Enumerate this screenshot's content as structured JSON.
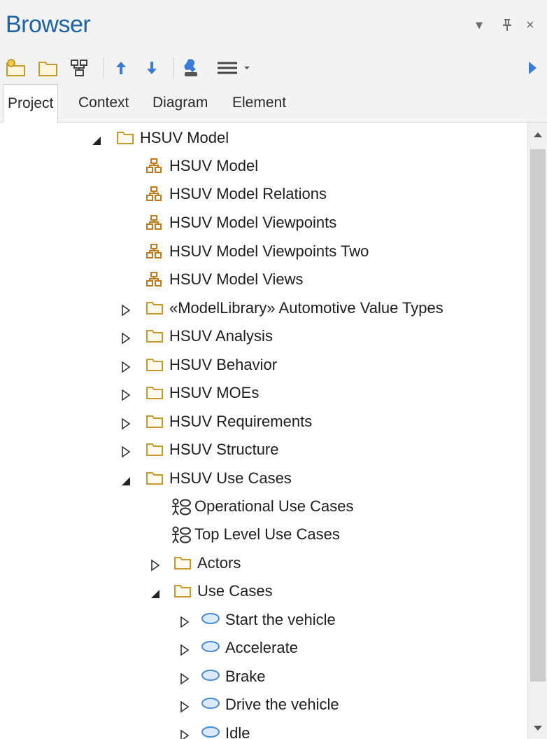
{
  "window": {
    "title": "Browser",
    "controls": {
      "menu": "▾",
      "pin": "⊥",
      "close": "×"
    }
  },
  "toolbar": {
    "buttons": [
      {
        "name": "new-package-icon"
      },
      {
        "name": "folder-icon"
      },
      {
        "name": "new-diagram-icon"
      },
      {
        "name": "move-up-icon"
      },
      {
        "name": "move-down-icon"
      },
      {
        "name": "properties-icon"
      },
      {
        "name": "menu-icon"
      }
    ],
    "overflow_icon": "play-arrow-icon"
  },
  "tabs": [
    {
      "label": "Project",
      "active": true
    },
    {
      "label": "Context",
      "active": false
    },
    {
      "label": "Diagram",
      "active": false
    },
    {
      "label": "Element",
      "active": false
    }
  ],
  "tree": [
    {
      "label": "HSUV Model",
      "icon": "folder",
      "expander": "expanded"
    },
    {
      "label": "HSUV Model",
      "icon": "diagram",
      "expander": "none"
    },
    {
      "label": "HSUV Model Relations",
      "icon": "diagram",
      "expander": "none"
    },
    {
      "label": "HSUV Model Viewpoints",
      "icon": "diagram",
      "expander": "none"
    },
    {
      "label": "HSUV Model Viewpoints Two",
      "icon": "diagram",
      "expander": "none"
    },
    {
      "label": "HSUV Model Views",
      "icon": "diagram",
      "expander": "none"
    },
    {
      "label": "«ModelLibrary» Automotive Value Types",
      "icon": "folder",
      "expander": "collapsed"
    },
    {
      "label": "HSUV Analysis",
      "icon": "folder",
      "expander": "collapsed"
    },
    {
      "label": "HSUV Behavior",
      "icon": "folder",
      "expander": "collapsed"
    },
    {
      "label": "HSUV MOEs",
      "icon": "folder",
      "expander": "collapsed"
    },
    {
      "label": "HSUV Requirements",
      "icon": "folder",
      "expander": "collapsed"
    },
    {
      "label": "HSUV Structure",
      "icon": "folder",
      "expander": "collapsed"
    },
    {
      "label": "HSUV Use Cases",
      "icon": "folder",
      "expander": "expanded"
    },
    {
      "label": "Operational Use Cases",
      "icon": "usecase-diagram",
      "expander": "none"
    },
    {
      "label": "Top Level Use Cases",
      "icon": "usecase-diagram",
      "expander": "none"
    },
    {
      "label": "Actors",
      "icon": "folder",
      "expander": "collapsed"
    },
    {
      "label": "Use Cases",
      "icon": "folder",
      "expander": "expanded"
    },
    {
      "label": "Start the vehicle",
      "icon": "usecase",
      "expander": "collapsed"
    },
    {
      "label": "Accelerate",
      "icon": "usecase",
      "expander": "collapsed"
    },
    {
      "label": "Brake",
      "icon": "usecase",
      "expander": "collapsed"
    },
    {
      "label": "Drive the vehicle",
      "icon": "usecase",
      "expander": "collapsed"
    },
    {
      "label": "Idle",
      "icon": "usecase",
      "expander": "collapsed"
    }
  ],
  "colors": {
    "title": "#1e62a8",
    "accent_arrow": "#3a7bd5",
    "folder_stroke": "#c79a2a",
    "folder_fill": "#fffaf0",
    "diagram_stroke": "#c17a1c",
    "usecase_stroke": "#4a8bd6",
    "usecase_fill": "#dcebfb"
  }
}
